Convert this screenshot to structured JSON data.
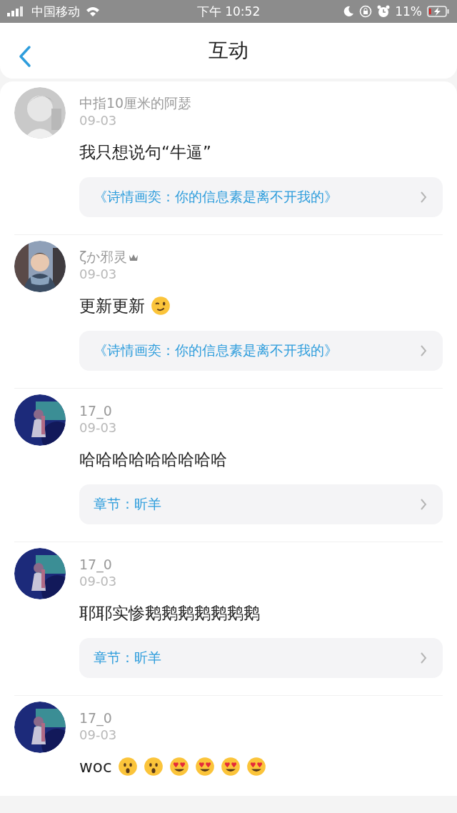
{
  "status_bar": {
    "carrier": "中国移动",
    "time": "下午 10:52",
    "battery": "11%"
  },
  "header": {
    "title": "互动"
  },
  "comments": [
    {
      "name": "中指10厘米的阿瑟",
      "badge": false,
      "date": "09-03",
      "text": "我只想说句“牛逼”",
      "link": "《诗情画奕：你的信息素是离不开我的》"
    },
    {
      "name": "ζか邪灵",
      "badge": true,
      "date": "09-03",
      "text": "更新更新",
      "emojis": [
        {
          "kind": "wink"
        }
      ],
      "link": "《诗情画奕：你的信息素是离不开我的》"
    },
    {
      "name": "17_0",
      "badge": false,
      "date": "09-03",
      "text": "哈哈哈哈哈哈哈哈哈",
      "link": "章节：昕羊"
    },
    {
      "name": "17_0",
      "badge": false,
      "date": "09-03",
      "text": "耶耶实惨鹅鹅鹅鹅鹅鹅鹅",
      "link": "章节：昕羊"
    },
    {
      "name": "17_0",
      "badge": false,
      "date": "09-03",
      "text": "woc",
      "emojis": [
        {
          "kind": "astonished"
        },
        {
          "kind": "astonished"
        },
        {
          "kind": "heart-eyes"
        },
        {
          "kind": "heart-eyes"
        },
        {
          "kind": "heart-eyes"
        },
        {
          "kind": "heart-eyes"
        }
      ]
    }
  ]
}
